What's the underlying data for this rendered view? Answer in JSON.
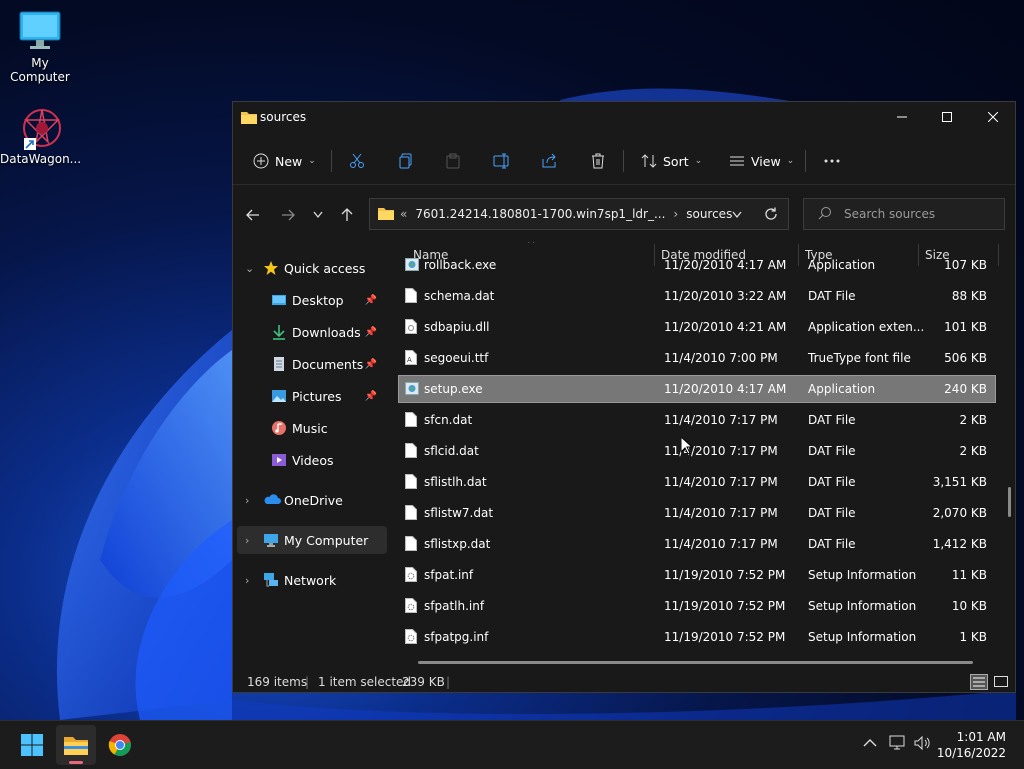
{
  "desktop": {
    "icons": [
      {
        "label": "My Computer",
        "icon": "monitor-icon"
      },
      {
        "label": "DataWagon...",
        "icon": "datawagon-app-icon"
      }
    ]
  },
  "window": {
    "title": "sources",
    "toolbar": {
      "new_label": "New",
      "sort_label": "Sort",
      "view_label": "View"
    },
    "address": {
      "prefix": "«",
      "segment1": "7601.24214.180801-1700.win7sp1_ldr_...",
      "separator": "›",
      "segment2": "sources"
    },
    "search": {
      "placeholder": "Search sources"
    },
    "sidebar": {
      "quick_access": "Quick access",
      "items": [
        {
          "label": "Desktop",
          "icon": "desktop-icon",
          "pinned": true
        },
        {
          "label": "Downloads",
          "icon": "download-icon",
          "pinned": true
        },
        {
          "label": "Documents",
          "icon": "documents-icon",
          "pinned": true
        },
        {
          "label": "Pictures",
          "icon": "pictures-icon",
          "pinned": true
        },
        {
          "label": "Music",
          "icon": "music-icon",
          "pinned": false
        },
        {
          "label": "Videos",
          "icon": "videos-icon",
          "pinned": false
        }
      ],
      "onedrive": "OneDrive",
      "mycomputer": "My Computer",
      "network": "Network"
    },
    "columns": {
      "name": "Name",
      "date": "Date modified",
      "type": "Type",
      "size": "Size"
    },
    "files": [
      {
        "name": "rollback.exe",
        "date": "11/20/2010 4:17 AM",
        "type": "Application",
        "size": "107 KB",
        "icon": "exe"
      },
      {
        "name": "schema.dat",
        "date": "11/20/2010 3:22 AM",
        "type": "DAT File",
        "size": "88 KB",
        "icon": "file"
      },
      {
        "name": "sdbapiu.dll",
        "date": "11/20/2010 4:21 AM",
        "type": "Application exten...",
        "size": "101 KB",
        "icon": "dll"
      },
      {
        "name": "segoeui.ttf",
        "date": "11/4/2010 7:00 PM",
        "type": "TrueType font file",
        "size": "506 KB",
        "icon": "font"
      },
      {
        "name": "setup.exe",
        "date": "11/20/2010 4:17 AM",
        "type": "Application",
        "size": "240 KB",
        "icon": "exe",
        "selected": true
      },
      {
        "name": "sfcn.dat",
        "date": "11/4/2010 7:17 PM",
        "type": "DAT File",
        "size": "2 KB",
        "icon": "file"
      },
      {
        "name": "sflcid.dat",
        "date": "11/4/2010 7:17 PM",
        "type": "DAT File",
        "size": "2 KB",
        "icon": "file"
      },
      {
        "name": "sflistlh.dat",
        "date": "11/4/2010 7:17 PM",
        "type": "DAT File",
        "size": "3,151 KB",
        "icon": "file"
      },
      {
        "name": "sflistw7.dat",
        "date": "11/4/2010 7:17 PM",
        "type": "DAT File",
        "size": "2,070 KB",
        "icon": "file"
      },
      {
        "name": "sflistxp.dat",
        "date": "11/4/2010 7:17 PM",
        "type": "DAT File",
        "size": "1,412 KB",
        "icon": "file"
      },
      {
        "name": "sfpat.inf",
        "date": "11/19/2010 7:52 PM",
        "type": "Setup Information",
        "size": "11 KB",
        "icon": "inf"
      },
      {
        "name": "sfpatlh.inf",
        "date": "11/19/2010 7:52 PM",
        "type": "Setup Information",
        "size": "10 KB",
        "icon": "inf"
      },
      {
        "name": "sfpatpg.inf",
        "date": "11/19/2010 7:52 PM",
        "type": "Setup Information",
        "size": "1 KB",
        "icon": "inf"
      }
    ],
    "status": {
      "items": "169 items",
      "selected": "1 item selected",
      "size": "239 KB"
    }
  },
  "taskbar": {
    "time": "1:01 AM",
    "date": "10/16/2022"
  }
}
